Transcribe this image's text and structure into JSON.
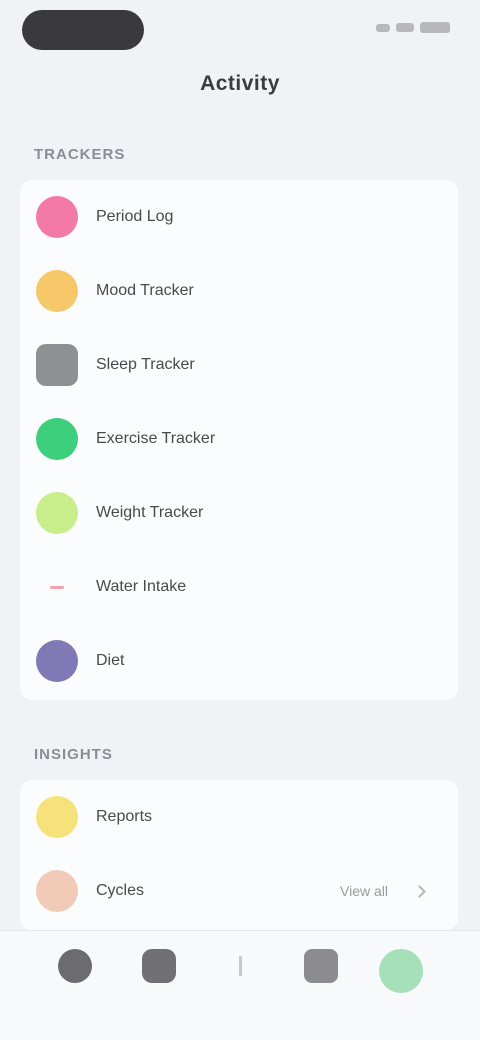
{
  "status_bar": {
    "time": ""
  },
  "nav": {
    "title": "Activity"
  },
  "sections": [
    {
      "header": "TRACKERS",
      "items": [
        {
          "label": "Period Log",
          "color": "#f27aa4"
        },
        {
          "label": "Mood Tracker",
          "color": "#f6c86a"
        },
        {
          "label": "Sleep Tracker",
          "color": "#8f9094"
        },
        {
          "label": "Exercise Tracker",
          "color": "#3ecf7d"
        },
        {
          "label": "Weight Tracker",
          "color": "#c7ee8a"
        },
        {
          "label": "Water Intake",
          "color": "#f2c2c8"
        },
        {
          "label": "Diet",
          "color": "#7f7ab5"
        }
      ]
    },
    {
      "header": "INSIGHTS",
      "items": [
        {
          "label": "Reports",
          "color": "#f5e27a",
          "value": ""
        },
        {
          "label": "Cycles",
          "color": "#f1cbb8",
          "value": "View all"
        }
      ]
    }
  ],
  "tabs": [
    {
      "label": "",
      "color": "#6b6b70"
    },
    {
      "label": "",
      "color": "#707075"
    },
    {
      "label": "",
      "color": "#c8c8cc"
    },
    {
      "label": "",
      "color": "#8c8c90"
    },
    {
      "label": "",
      "color": "#a6e0b8"
    }
  ]
}
